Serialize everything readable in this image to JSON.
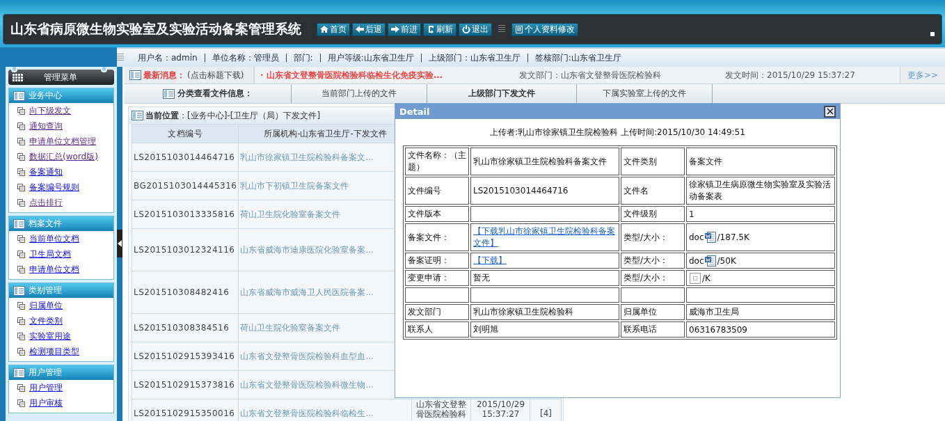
{
  "header": {
    "title": "山东省病原微生物实验室及实验活动备案管理系统",
    "buttons": [
      {
        "label": "首页"
      },
      {
        "label": "后退"
      },
      {
        "label": "前进"
      },
      {
        "label": "刷新"
      },
      {
        "label": "退出"
      }
    ],
    "profile_button": {
      "label": "个人资料修改"
    }
  },
  "user_bar": [
    "用户名：admin",
    "单位名称：管理员",
    "部门:",
    "用户等级:山东省卫生厅",
    "上级部门：山东省卫生厅",
    "签核部门:山东省卫生厅"
  ],
  "sidebar": {
    "title": "管理菜单",
    "groups": [
      {
        "title": "业务中心",
        "items": [
          {
            "label": "向下级发文",
            "visited": true
          },
          {
            "label": "通知查询",
            "visited": true
          },
          {
            "label": "申请单位文档管理",
            "visited": true
          },
          {
            "label": "数据汇总(word版)",
            "visited": true
          },
          {
            "label": "备案通知",
            "visited": false
          },
          {
            "label": "备案编号规则",
            "visited": false
          },
          {
            "label": "点击排行",
            "visited": true
          }
        ]
      },
      {
        "title": "档案文件",
        "items": [
          {
            "label": "当前单位文档",
            "visited": false
          },
          {
            "label": "卫生局文档",
            "visited": false
          },
          {
            "label": "申请单位文档",
            "visited": false
          }
        ]
      },
      {
        "title": "类别管理",
        "items": [
          {
            "label": "归属单位",
            "visited": false
          },
          {
            "label": "文件类别",
            "visited": false
          },
          {
            "label": "实验室用途",
            "visited": false
          },
          {
            "label": "检测项目类型",
            "visited": false
          }
        ]
      },
      {
        "title": "用户管理",
        "items": [
          {
            "label": "用户管理",
            "visited": false
          },
          {
            "label": "用户审核",
            "visited": false
          }
        ]
      }
    ]
  },
  "news": {
    "label": "最新消息：",
    "hint": "(点击标题下载)",
    "headline": "· 山东省文登整骨医院检验科临检生化免疫实验...",
    "department": "发文部门：山东省文登整骨医院检验科",
    "time": "发文时间：2015/10/29 15:37:27",
    "more": "更多>>"
  },
  "category_tabs": {
    "label": "分类查看文件信息：",
    "tabs": [
      {
        "label": "当前部门上传的文件",
        "selected": false
      },
      {
        "label": "上级部门下发文件",
        "selected": true
      },
      {
        "label": "下属实验室上传的文件",
        "selected": false
      }
    ]
  },
  "location": "**当前位置**：[业务中心]-[卫生厅（局）下发文件]",
  "table": {
    "columns": [
      "文档编号",
      "所属机构-山东省卫生厅-下发文件"
    ],
    "rows": [
      {
        "cells": [
          "LS2015103014464716",
          "乳山市徐家镇卫生院检验科备案文..."
        ],
        "tall": false
      },
      {
        "cells": [
          "BG2015103014445316",
          "乳山市下初镇卫生院备案文件"
        ],
        "tall": false
      },
      {
        "cells": [
          "LS2015103013335816",
          "荷山卫生院化验室备案文件"
        ],
        "tall": false
      },
      {
        "cells": [
          "LS2015103012324116",
          "山东省威海市迪康医院化验室备案..."
        ],
        "tall": true
      },
      {
        "cells": [
          "LS201510308482416",
          "山东省威海市威海卫人民医院备案..."
        ],
        "tall": true
      },
      {
        "cells": [
          "LS201510308384516",
          "荷山卫生院化验室备案文件"
        ],
        "tall": false
      },
      {
        "cells": [
          "LS2015102915393416",
          "山东省文登整骨医院检验科血型血..."
        ],
        "tall": false
      },
      {
        "cells": [
          "LS2015102915373816",
          "山东省文登整骨医院检验科微生物..."
        ],
        "tall": false
      },
      {
        "cells": [
          "LS2015102915350016",
          "山东省文登整骨医院检验科临检生...",
          "山东省文登整骨医院检验科",
          "2015/10/29 15:37:27",
          "[4]"
        ],
        "tall": false
      }
    ]
  },
  "dialog": {
    "title": "Detail",
    "uploader": "上传者:乳山市徐家镇卫生院检验科 上传时间:2015/10/30 14:49:51",
    "rows": [
      {
        "cells": [
          {
            "kind": "text",
            "text": "文件名称：（主题）"
          },
          {
            "kind": "text",
            "text": "乳山市徐家镇卫生院检验科备案文件"
          },
          {
            "kind": "text",
            "text": "文件类别"
          },
          {
            "kind": "text",
            "text": "备案文件"
          }
        ]
      },
      {
        "cells": [
          {
            "kind": "text",
            "text": "文件编号"
          },
          {
            "kind": "text",
            "text": "LS2015103014464716"
          },
          {
            "kind": "text",
            "text": "文件名"
          },
          {
            "kind": "text",
            "text": "徐家镇卫生病原微生物实验室及实验活动备案表"
          }
        ]
      },
      {
        "cells": [
          {
            "kind": "text",
            "text": "文件版本"
          },
          {
            "kind": "empty"
          },
          {
            "kind": "text",
            "text": "文件级别"
          },
          {
            "kind": "text",
            "text": "1"
          }
        ]
      },
      {
        "cells": [
          {
            "kind": "text",
            "text": "备案文件："
          },
          {
            "kind": "link",
            "text": "【下载乳山市徐家镇卫生院检验科备案文件】"
          },
          {
            "kind": "text",
            "text": "类型/大小："
          },
          {
            "kind": "file",
            "type": "doc",
            "size": "/187.5K"
          }
        ]
      },
      {
        "cells": [
          {
            "kind": "text",
            "text": "备案证明："
          },
          {
            "kind": "link",
            "text": "【下载】"
          },
          {
            "kind": "text",
            "text": "类型/大小："
          },
          {
            "kind": "file",
            "type": "doc",
            "size": "/50K"
          }
        ]
      },
      {
        "cells": [
          {
            "kind": "text",
            "text": "变更申请："
          },
          {
            "kind": "text",
            "text": "暂无"
          },
          {
            "kind": "text",
            "text": "类型/大小："
          },
          {
            "kind": "missing-file",
            "size": "/K"
          }
        ]
      },
      {
        "cells": [
          {
            "kind": "empty"
          },
          {
            "kind": "empty"
          },
          {
            "kind": "empty"
          },
          {
            "kind": "empty"
          }
        ]
      },
      {
        "cells": [
          {
            "kind": "text",
            "text": "发文部门"
          },
          {
            "kind": "text",
            "text": "乳山市徐家镇卫生院检验科"
          },
          {
            "kind": "text",
            "text": "归属单位"
          },
          {
            "kind": "text",
            "text": "威海市卫生局"
          }
        ]
      },
      {
        "cells": [
          {
            "kind": "text",
            "text": "联系人"
          },
          {
            "kind": "text",
            "text": "刘明旭"
          },
          {
            "kind": "text",
            "text": "联系电话"
          },
          {
            "kind": "text",
            "text": "06316783509"
          }
        ]
      }
    ]
  }
}
